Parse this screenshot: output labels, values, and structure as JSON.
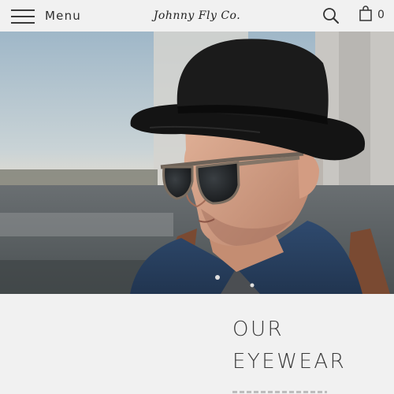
{
  "header": {
    "menu_label": "Menu",
    "logo_text": "Johnny Fly Co.",
    "cart_count": "0"
  },
  "hero": {
    "image": "man-with-black-hat-and-sunglasses"
  },
  "section": {
    "title": "OUR\nEYEWEAR"
  },
  "colors": {
    "header_bg": "#f1f1f1",
    "page_bg": "#f1f1f1",
    "text": "#3a3a3a"
  },
  "icons": [
    "hamburger-icon",
    "search-icon",
    "shopping-bag-icon"
  ]
}
